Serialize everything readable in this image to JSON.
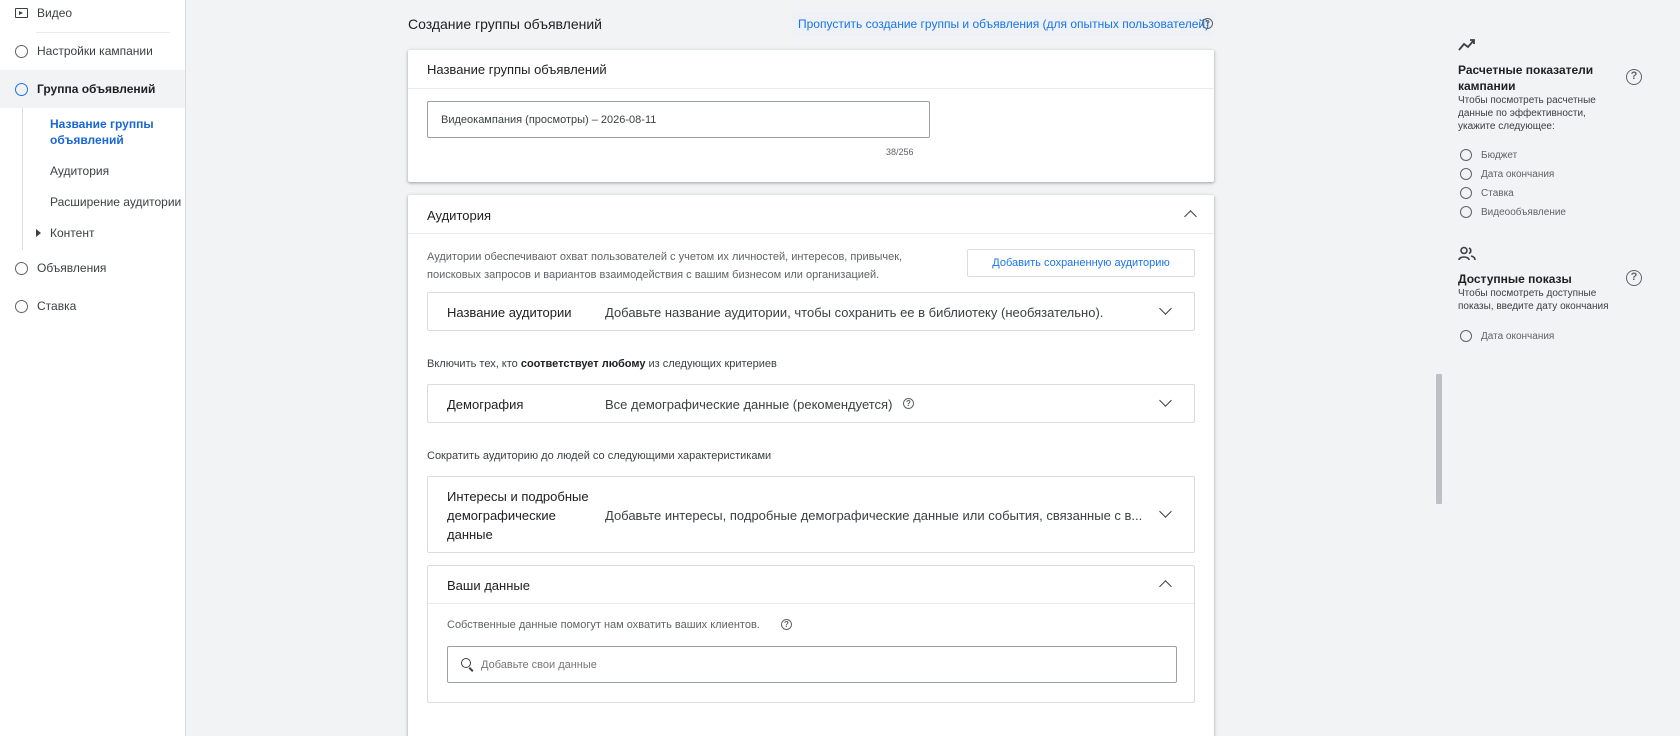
{
  "sidebar": {
    "items": [
      {
        "label": "Видео"
      },
      {
        "label": "Настройки кампании"
      },
      {
        "label": "Группа объявлений"
      },
      {
        "label": "Объявления"
      },
      {
        "label": "Ставка"
      }
    ],
    "subitems": [
      {
        "label": "Название группы объявлений"
      },
      {
        "label": "Аудитория"
      },
      {
        "label": "Расширение аудитории"
      },
      {
        "label": "Контент"
      }
    ]
  },
  "header": {
    "title": "Создание группы объявлений",
    "skip_link": "Пропустить создание группы и объявления (для опытных пользователей)"
  },
  "ad_group_name": {
    "title": "Название группы объявлений",
    "value": "Видеокампания (просмотры) – 2026-08-11",
    "counter": "38/256"
  },
  "audience": {
    "title": "Аудитория",
    "description": "Аудитории обеспечивают охват пользователей с учетом их личностей, интересов, привычек, поисковых запросов и вариантов взаимодействия с вашим бизнесом или организацией.",
    "add_saved_button": "Добавить сохраненную аудиторию",
    "name_row": {
      "key": "Название аудитории",
      "value": "Добавьте название аудитории, чтобы сохранить ее в библиотеку (необязательно)."
    },
    "include_prefix": "Включить тех, кто",
    "include_bold": "соответствует любому",
    "include_suffix": "из следующих критериев",
    "demographics_row": {
      "key": "Демография",
      "value": "Все демографические данные (рекомендуется)"
    },
    "narrow_text": "Сократить аудиторию до людей со следующими характеристиками",
    "interests_row": {
      "key": "Интересы и подробные демографические данные",
      "value": "Добавьте интересы, подробные демографические данные или события, связанные с в..."
    },
    "your_data": {
      "title": "Ваши данные",
      "description": "Собственные данные помогут нам охватить ваших клиентов.",
      "search_placeholder": "Добавьте свои данные"
    }
  },
  "right_panel": {
    "estimates": {
      "title": "Расчетные показатели кампании",
      "description": "Чтобы посмотреть расчетные данные по эффективности, укажите следующее:",
      "options": [
        "Бюджет",
        "Дата окончания",
        "Ставка",
        "Видеообъявление"
      ]
    },
    "impressions": {
      "title": "Доступные показы",
      "description": "Чтобы посмотреть доступные показы, введите дату окончания",
      "options": [
        "Дата окончания"
      ]
    }
  }
}
